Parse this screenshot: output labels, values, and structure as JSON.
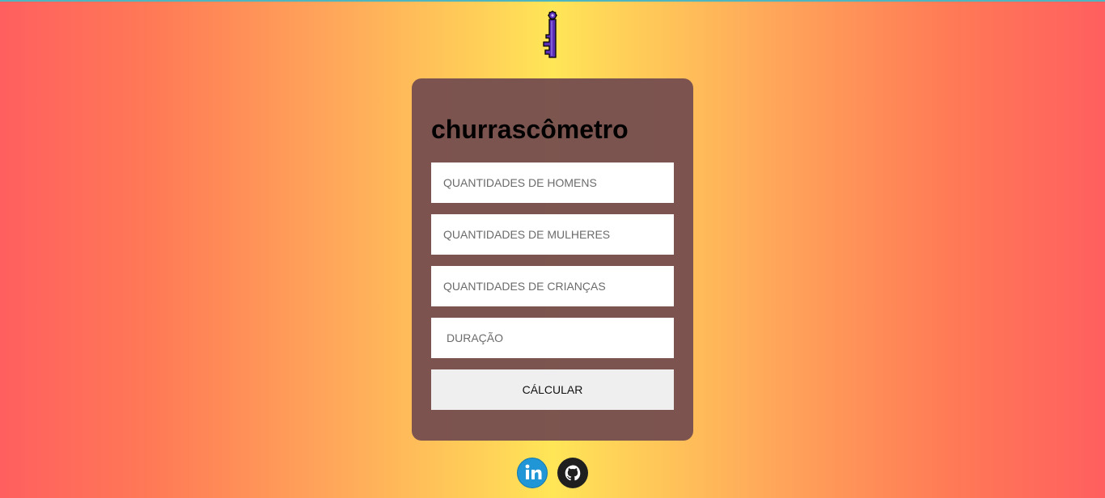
{
  "page": {
    "background_colors": [
      "#ff5f5f",
      "#ffe657"
    ],
    "top_line_color": "#4fb6c0"
  },
  "logo": {
    "icon": "key-icon",
    "color": "#5b2fb5"
  },
  "card": {
    "title": "churrascômetro",
    "background": "#78504e",
    "fields": {
      "men": {
        "placeholder": "QUANTIDADES DE HOMENS",
        "value": ""
      },
      "women": {
        "placeholder": "QUANTIDADES DE MULHERES",
        "value": ""
      },
      "children": {
        "placeholder": "QUANTIDADES DE CRIANÇAS",
        "value": ""
      },
      "duration": {
        "placeholder": "DURAÇÃO",
        "value": ""
      }
    },
    "calculate_label": "CÁLCULAR"
  },
  "social": {
    "linkedin": {
      "icon": "linkedin-icon",
      "label": "in",
      "color": "#2196d6"
    },
    "github": {
      "icon": "github-icon",
      "color": "#1f1f1f"
    }
  }
}
